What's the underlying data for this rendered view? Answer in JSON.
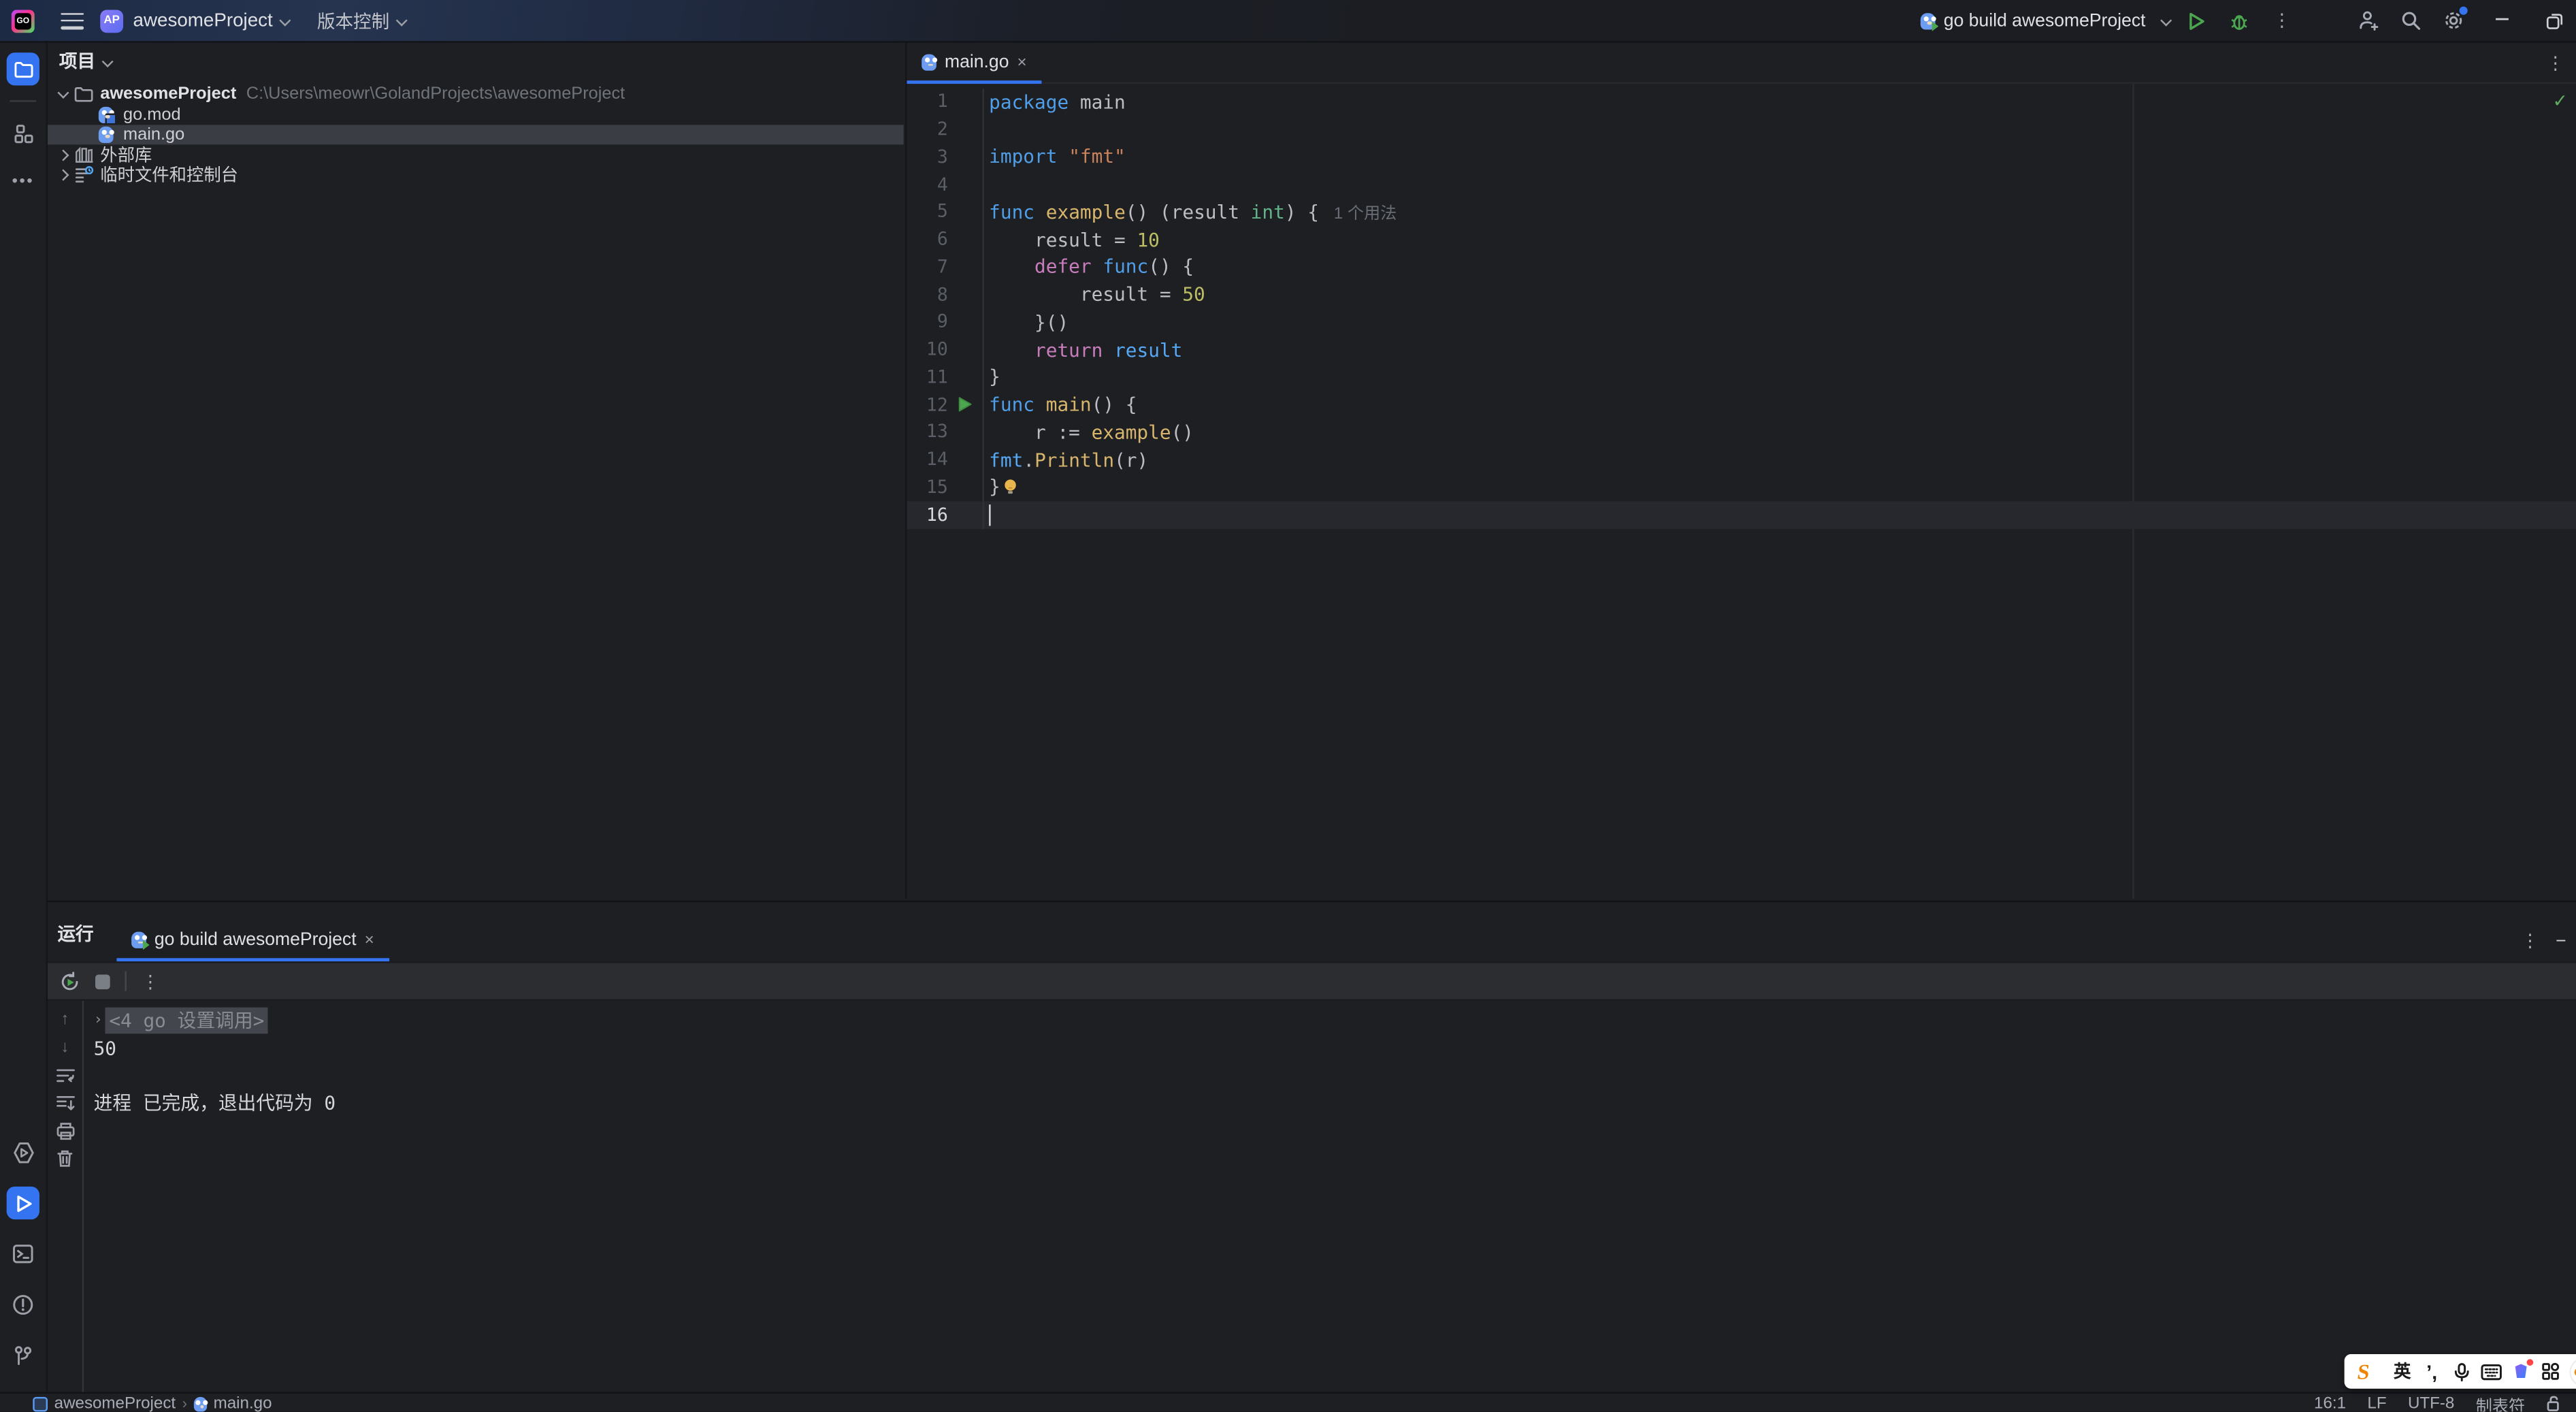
{
  "titlebar": {
    "logo_text": "GO",
    "project_badge": "AP",
    "project_name": "awesomeProject",
    "vcs_label": "版本控制",
    "run_config": "go build awesomeProject"
  },
  "project_panel": {
    "header": "项目",
    "tree": [
      {
        "kind": "root",
        "icon": "folder-icon",
        "chevron": "expanded",
        "name": "awesomeProject",
        "path": "C:\\Users\\meowr\\GolandProjects\\awesomeProject",
        "indent": 1,
        "selected": false
      },
      {
        "kind": "file",
        "icon": "gomod-file-icon",
        "chevron": "none",
        "name": "go.mod",
        "path": "",
        "indent": 2,
        "selected": false
      },
      {
        "kind": "file",
        "icon": "go-file-icon",
        "chevron": "none",
        "name": "main.go",
        "path": "",
        "indent": 2,
        "selected": true
      },
      {
        "kind": "group",
        "icon": "external-libraries-icon",
        "chevron": "collapsed",
        "name": "外部库",
        "path": "",
        "indent": 1,
        "selected": false
      },
      {
        "kind": "group",
        "icon": "scratches-icon",
        "chevron": "collapsed",
        "name": "临时文件和控制台",
        "path": "",
        "indent": 1,
        "selected": false
      }
    ]
  },
  "editor": {
    "tab_label": "main.go",
    "inspection_ok_glyph": "✓",
    "lines": [
      {
        "no": "1",
        "tokens": [
          [
            "k",
            "package"
          ],
          [
            "p",
            " main"
          ]
        ],
        "run": false,
        "bulb": false,
        "caret": false,
        "current": false
      },
      {
        "no": "2",
        "tokens": [],
        "run": false,
        "bulb": false,
        "caret": false,
        "current": false
      },
      {
        "no": "3",
        "tokens": [
          [
            "k",
            "import"
          ],
          [
            "p",
            " "
          ],
          [
            "s",
            "\"fmt\""
          ]
        ],
        "run": false,
        "bulb": false,
        "caret": false,
        "current": false
      },
      {
        "no": "4",
        "tokens": [],
        "run": false,
        "bulb": false,
        "caret": false,
        "current": false
      },
      {
        "no": "5",
        "tokens": [
          [
            "k",
            "func"
          ],
          [
            "p",
            " "
          ],
          [
            "f",
            "example"
          ],
          [
            "p",
            "() ("
          ],
          [
            "p",
            "result "
          ],
          [
            "t",
            "int"
          ],
          [
            "p",
            ") {"
          ],
          [
            "h",
            "1 个用法"
          ]
        ],
        "run": false,
        "bulb": false,
        "caret": false,
        "current": false
      },
      {
        "no": "6",
        "tokens": [
          [
            "p",
            "    result = "
          ],
          [
            "n",
            "10"
          ]
        ],
        "run": false,
        "bulb": false,
        "caret": false,
        "current": false
      },
      {
        "no": "7",
        "tokens": [
          [
            "p",
            "    "
          ],
          [
            "d",
            "defer"
          ],
          [
            "p",
            " "
          ],
          [
            "k",
            "func"
          ],
          [
            "p",
            "() {"
          ]
        ],
        "run": false,
        "bulb": false,
        "caret": false,
        "current": false
      },
      {
        "no": "8",
        "tokens": [
          [
            "p",
            "        result = "
          ],
          [
            "n",
            "50"
          ]
        ],
        "run": false,
        "bulb": false,
        "caret": false,
        "current": false
      },
      {
        "no": "9",
        "tokens": [
          [
            "p",
            "    }()"
          ]
        ],
        "run": false,
        "bulb": false,
        "caret": false,
        "current": false
      },
      {
        "no": "10",
        "tokens": [
          [
            "p",
            "    "
          ],
          [
            "d",
            "return"
          ],
          [
            "p",
            " "
          ],
          [
            "r",
            "result"
          ]
        ],
        "run": false,
        "bulb": false,
        "caret": false,
        "current": false
      },
      {
        "no": "11",
        "tokens": [
          [
            "p",
            "}"
          ]
        ],
        "run": false,
        "bulb": false,
        "caret": false,
        "current": false
      },
      {
        "no": "12",
        "tokens": [
          [
            "k",
            "func"
          ],
          [
            "p",
            " "
          ],
          [
            "f",
            "main"
          ],
          [
            "p",
            "() {"
          ]
        ],
        "run": true,
        "bulb": false,
        "caret": false,
        "current": false
      },
      {
        "no": "13",
        "tokens": [
          [
            "p",
            "    r := "
          ],
          [
            "f",
            "example"
          ],
          [
            "p",
            "()"
          ]
        ],
        "run": false,
        "bulb": false,
        "caret": false,
        "current": false
      },
      {
        "no": "14",
        "tokens": [
          [
            "r",
            "fmt"
          ],
          [
            "p",
            "."
          ],
          [
            "f",
            "Println"
          ],
          [
            "p",
            "(r)"
          ]
        ],
        "run": false,
        "bulb": false,
        "caret": false,
        "current": false
      },
      {
        "no": "15",
        "tokens": [
          [
            "p",
            "}"
          ]
        ],
        "run": false,
        "bulb": true,
        "caret": false,
        "current": false
      },
      {
        "no": "16",
        "tokens": [],
        "run": false,
        "bulb": false,
        "caret": true,
        "current": true
      }
    ]
  },
  "run_panel": {
    "title": "运行",
    "tab_label": "go build awesomeProject",
    "console": [
      {
        "fold": true,
        "text": "<4 go 设置调用>"
      },
      {
        "fold": false,
        "text": "50"
      },
      {
        "fold": false,
        "text": ""
      },
      {
        "fold": false,
        "text": "进程 已完成，退出代码为 0"
      }
    ]
  },
  "status_bar": {
    "project": "awesomeProject",
    "separator": "›",
    "file": "main.go",
    "caret_position": "16:1",
    "line_ending": "LF",
    "encoding": "UTF-8",
    "indent_style": "制表符"
  },
  "ime_bar": {
    "logo": "S",
    "mode": "英"
  },
  "icons": {
    "more_vertical": "⋮",
    "minus": "−",
    "close": "×",
    "arrow_up": "↑",
    "arrow_down": "↓",
    "check": "✓",
    "fold_chevron": "›"
  },
  "colors": {
    "accent_blue": "#3574F0",
    "run_green": "#4CA54F",
    "keyword_blue": "#509EE8",
    "keyword_magenta": "#C77DBB",
    "string_orange": "#C9825C",
    "number_olive": "#BCBE66",
    "function_yellow": "#D7B56D",
    "type_green": "#63B38A",
    "reference_blue": "#56A8F5",
    "selection_gray": "#3A3D43",
    "background": "#1E1F22"
  }
}
